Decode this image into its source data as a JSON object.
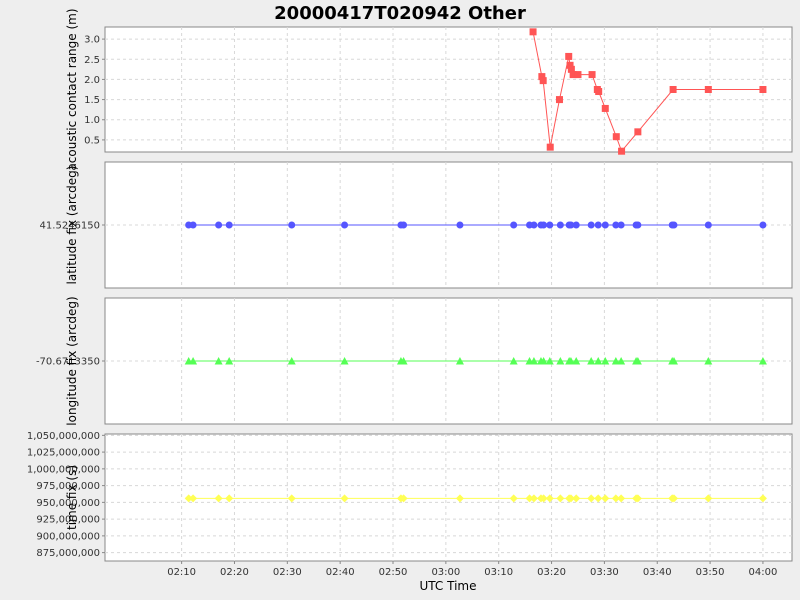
{
  "title": "20000417T020942 Other",
  "xlabel": "UTC Time",
  "x_ticks": [
    "02:10",
    "02:20",
    "02:30",
    "02:40",
    "02:50",
    "03:00",
    "03:10",
    "03:20",
    "03:30",
    "03:40",
    "03:50",
    "04:00"
  ],
  "colors": {
    "range": "#ff5555",
    "latitude": "#5555ff",
    "longitude": "#55ff55",
    "time": "#ffff55"
  },
  "chart_data": [
    {
      "type": "line",
      "ylabel": "acoustic contact range (m)",
      "ylim": [
        0.2,
        3.3
      ],
      "y_ticks": [
        "0.5",
        "1.0",
        "1.5",
        "2.0",
        "2.5",
        "3.0"
      ],
      "marker": "square",
      "x": [
        "03:16:30",
        "03:18:10",
        "03:18:25",
        "03:19:45",
        "03:21:30",
        "03:23:15",
        "03:23:30",
        "03:23:45",
        "03:24:05",
        "03:25:00",
        "03:27:40",
        "03:28:40",
        "03:28:55",
        "03:30:10",
        "03:32:15",
        "03:33:15",
        "03:36:20",
        "03:43:00",
        "03:49:40",
        "04:00:00"
      ],
      "y": [
        3.18,
        2.07,
        1.97,
        0.32,
        1.5,
        2.57,
        2.35,
        2.25,
        2.12,
        2.12,
        2.12,
        1.75,
        1.7,
        1.28,
        0.58,
        0.22,
        0.7,
        1.75,
        1.75,
        1.75
      ]
    },
    {
      "type": "line",
      "ylabel": "latitude fix (arcdeg)",
      "y_ticks": [
        "41.5246150"
      ],
      "marker": "circle",
      "x": [
        "02:11:20",
        "02:12:10",
        "02:17:00",
        "02:19:00",
        "02:30:50",
        "02:40:50",
        "02:51:30",
        "02:52:00",
        "03:02:40",
        "03:12:50",
        "03:15:50",
        "03:16:40",
        "03:18:00",
        "03:18:30",
        "03:19:40",
        "03:21:40",
        "03:23:20",
        "03:23:40",
        "03:24:40",
        "03:27:30",
        "03:28:50",
        "03:30:10",
        "03:32:10",
        "03:33:10",
        "03:36:00",
        "03:36:20",
        "03:42:50",
        "03:43:10",
        "03:49:40",
        "04:00:00"
      ],
      "y": [
        41.524615,
        41.524615,
        41.524615,
        41.524615,
        41.524615,
        41.524615,
        41.524615,
        41.524615,
        41.524615,
        41.524615,
        41.524615,
        41.524615,
        41.524615,
        41.524615,
        41.524615,
        41.524615,
        41.524615,
        41.524615,
        41.524615,
        41.524615,
        41.524615,
        41.524615,
        41.524615,
        41.524615,
        41.524615,
        41.524615,
        41.524615,
        41.524615,
        41.524615,
        41.524615
      ]
    },
    {
      "type": "line",
      "ylabel": "longitude fix (arcdeg)",
      "y_ticks": [
        "-70.6713350"
      ],
      "marker": "triangle",
      "x": [
        "02:11:20",
        "02:12:10",
        "02:17:00",
        "02:19:00",
        "02:30:50",
        "02:40:50",
        "02:51:30",
        "02:52:00",
        "03:02:40",
        "03:12:50",
        "03:15:50",
        "03:16:40",
        "03:18:00",
        "03:18:30",
        "03:19:40",
        "03:21:40",
        "03:23:20",
        "03:23:40",
        "03:24:40",
        "03:27:30",
        "03:28:50",
        "03:30:10",
        "03:32:10",
        "03:33:10",
        "03:36:00",
        "03:36:20",
        "03:42:50",
        "03:43:10",
        "03:49:40",
        "04:00:00"
      ],
      "y": [
        -70.671335,
        -70.671335,
        -70.671335,
        -70.671335,
        -70.671335,
        -70.671335,
        -70.671335,
        -70.671335,
        -70.671335,
        -70.671335,
        -70.671335,
        -70.671335,
        -70.671335,
        -70.671335,
        -70.671335,
        -70.671335,
        -70.671335,
        -70.671335,
        -70.671335,
        -70.671335,
        -70.671335,
        -70.671335,
        -70.671335,
        -70.671335,
        -70.671335,
        -70.671335,
        -70.671335,
        -70.671335,
        -70.671335,
        -70.671335
      ]
    },
    {
      "type": "line",
      "ylabel": "time fix (s)",
      "ylim": [
        862500000,
        1052000000
      ],
      "y_ticks": [
        "875,000,000",
        "900,000,000",
        "925,000,000",
        "950,000,000",
        "975,000,000",
        "1,000,000,000",
        "1,025,000,000",
        "1,050,000,000"
      ],
      "marker": "diamond",
      "x": [
        "02:11:20",
        "02:12:10",
        "02:17:00",
        "02:19:00",
        "02:30:50",
        "02:40:50",
        "02:51:30",
        "02:52:00",
        "03:02:40",
        "03:12:50",
        "03:15:50",
        "03:16:40",
        "03:18:00",
        "03:18:30",
        "03:19:40",
        "03:21:40",
        "03:23:20",
        "03:23:40",
        "03:24:40",
        "03:27:30",
        "03:28:50",
        "03:30:10",
        "03:32:10",
        "03:33:10",
        "03:36:00",
        "03:36:20",
        "03:42:50",
        "03:43:10",
        "03:49:40",
        "04:00:00"
      ],
      "y": [
        956000000,
        956000000,
        956000000,
        956000000,
        956000000,
        956000000,
        956000000,
        956000000,
        956000000,
        956000000,
        956000000,
        956000000,
        956000000,
        956000000,
        956000000,
        956000000,
        956000000,
        956000000,
        956000000,
        956000000,
        956000000,
        956000000,
        956000000,
        956000000,
        956000000,
        956000000,
        956000000,
        956000000,
        956000000,
        956000000
      ]
    }
  ]
}
